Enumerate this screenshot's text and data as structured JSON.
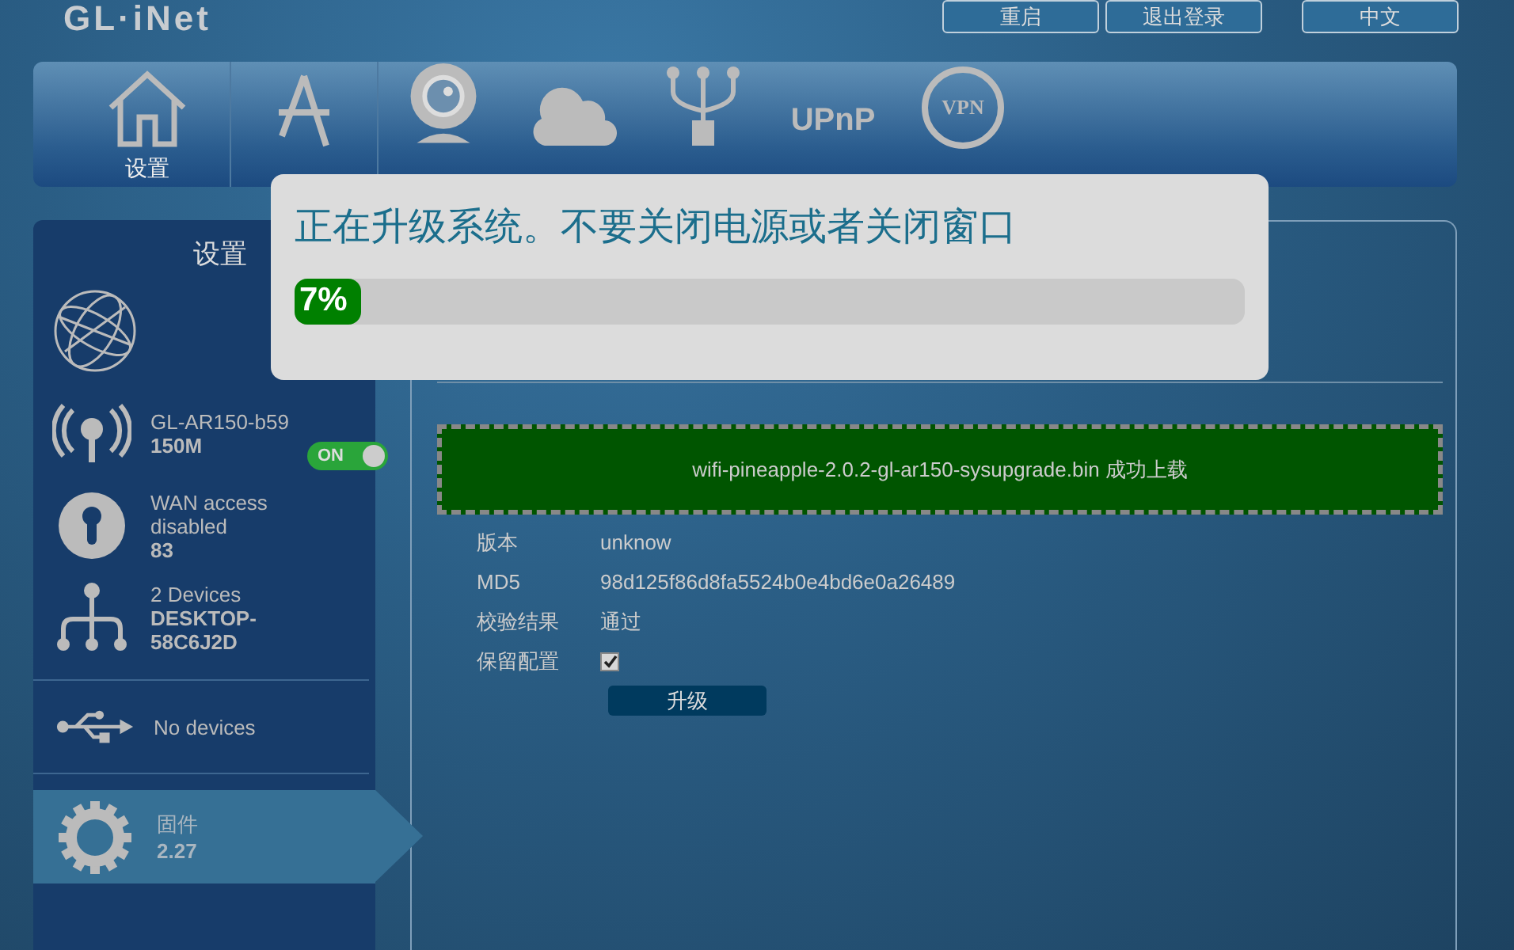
{
  "header": {
    "logo": "GL·iNet",
    "buttons": [
      "重启",
      "退出登录"
    ],
    "language": "中文"
  },
  "nav": [
    {
      "kind": "home",
      "label": "设置"
    },
    {
      "kind": "apps"
    },
    {
      "kind": "camera"
    },
    {
      "kind": "cloud"
    },
    {
      "kind": "share"
    },
    {
      "kind": "upnp",
      "icon_text": "UPnP"
    },
    {
      "kind": "vpn",
      "icon_text": "VPN"
    }
  ],
  "sidebar": {
    "title": "设置",
    "wifi": {
      "ssid": "GL-AR150-b59",
      "speed": "150M",
      "toggle_label": "ON",
      "on": true
    },
    "wan": {
      "status": "WAN access disabled",
      "value": "83"
    },
    "clients": {
      "count": "2 Devices",
      "name": "DESKTOP-58C6J2D"
    },
    "usb": {
      "status": "No devices"
    },
    "firmware": {
      "label": "固件",
      "version": "2.27",
      "selected": true
    }
  },
  "upload": {
    "message": "wifi-pineapple-2.0.2-gl-ar150-sysupgrade.bin 成功上载",
    "fields": [
      {
        "label": "版本",
        "value": "unknow"
      },
      {
        "label": "MD5",
        "value": "98d125f86d8fa5524b0e4bd6e0a26489"
      },
      {
        "label": "校验结果",
        "value": "通过"
      }
    ],
    "keep_config": {
      "label": "保留配置",
      "checked": true
    },
    "button": "升级"
  },
  "modal": {
    "message": "正在升级系统。不要关闭电源或者关闭窗口",
    "progress": {
      "label": "7%",
      "level": 0.07
    }
  }
}
